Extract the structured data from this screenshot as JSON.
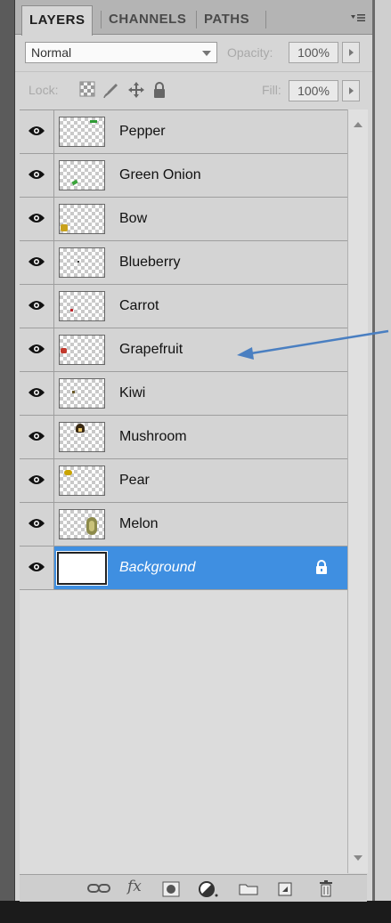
{
  "tabs": [
    {
      "label": "LAYERS",
      "active": true
    },
    {
      "label": "CHANNELS",
      "active": false
    },
    {
      "label": "PATHS",
      "active": false
    }
  ],
  "blend_mode": "Normal",
  "opacity_label": "Opacity:",
  "opacity_value": "100%",
  "lock_label": "Lock:",
  "fill_label": "Fill:",
  "fill_value": "100%",
  "layers": [
    {
      "name": "Pepper",
      "visible": true,
      "thumb": "pepper"
    },
    {
      "name": "Green Onion",
      "visible": true,
      "thumb": "green-onion"
    },
    {
      "name": "Bow",
      "visible": true,
      "thumb": "bow"
    },
    {
      "name": "Blueberry",
      "visible": true,
      "thumb": "blueberry"
    },
    {
      "name": "Carrot",
      "visible": true,
      "thumb": "carrot"
    },
    {
      "name": "Grapefruit",
      "visible": true,
      "thumb": "grapefruit"
    },
    {
      "name": "Kiwi",
      "visible": true,
      "thumb": "kiwi"
    },
    {
      "name": "Mushroom",
      "visible": true,
      "thumb": "mushroom"
    },
    {
      "name": "Pear",
      "visible": true,
      "thumb": "pear"
    },
    {
      "name": "Melon",
      "visible": true,
      "thumb": "melon"
    },
    {
      "name": "Background",
      "visible": true,
      "thumb": "white",
      "selected": true,
      "locked": true
    }
  ],
  "colors": {
    "selection": "#3f8fe1",
    "annotation_arrow": "#4a7fc1"
  },
  "icons": {
    "eye": "eye-icon",
    "lock": "lock-icon",
    "link": "link-layers-icon",
    "fx": "layer-style-icon",
    "mask": "add-mask-icon",
    "adjustment": "adjustment-layer-icon",
    "group": "new-group-icon",
    "new_layer": "new-layer-icon",
    "trash": "delete-layer-icon"
  },
  "toolbar": {
    "fx_label": "fx"
  }
}
